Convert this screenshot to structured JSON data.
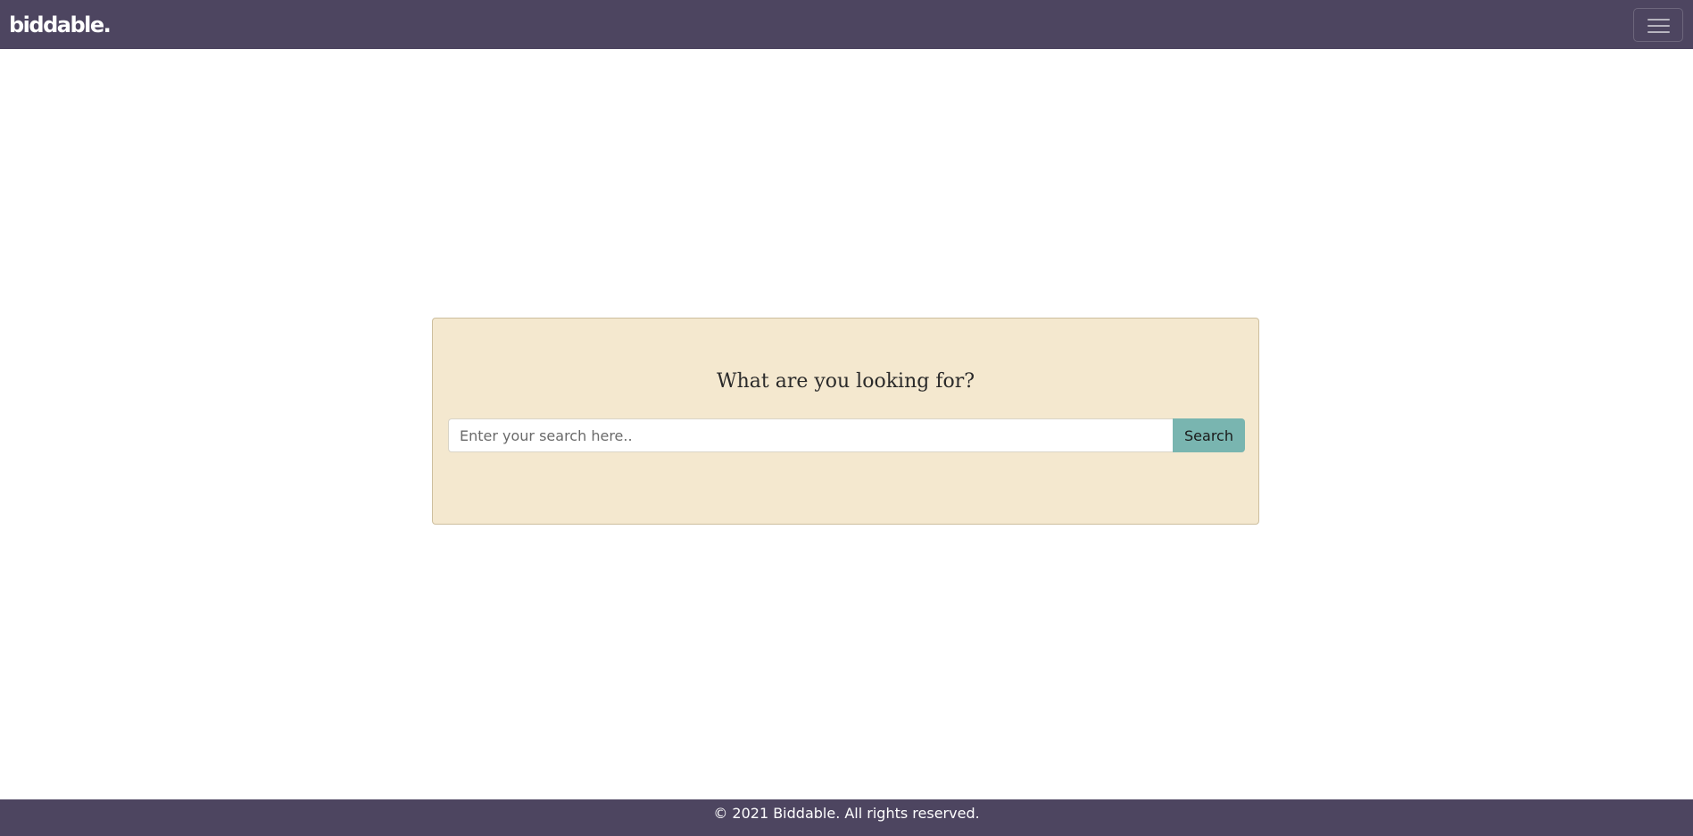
{
  "header": {
    "brand": "biddable.",
    "menu_icon": "hamburger-menu-icon"
  },
  "search": {
    "title": "What are you looking for?",
    "placeholder": "Enter your search here..",
    "value": "",
    "button_label": "Search"
  },
  "footer": {
    "text": "© 2021 Biddable. All rights reserved."
  },
  "colors": {
    "navbar": "#4d4560",
    "card_background": "#f4e8cf",
    "search_button": "#79b5b0"
  }
}
